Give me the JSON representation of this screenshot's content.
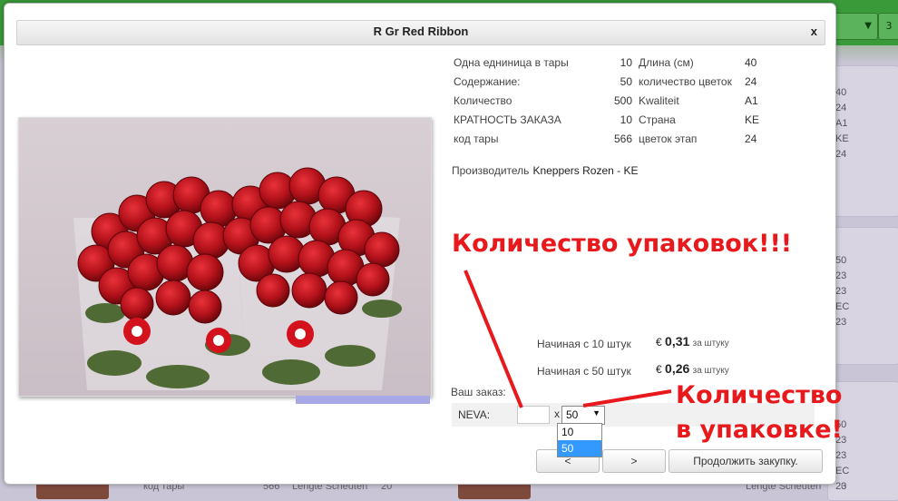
{
  "modal": {
    "title": "R Gr Red Ribbon",
    "close_label": "x"
  },
  "specs_left": [
    {
      "label": "Одна едниница в тары",
      "value": "10"
    },
    {
      "label": "Содержание:",
      "value": "50"
    },
    {
      "label": "Количество",
      "value": "500"
    },
    {
      "label": "КРАТНОСТЬ ЗАКАЗА",
      "value": "10"
    },
    {
      "label": "код тары",
      "value": "566"
    }
  ],
  "specs_right": [
    {
      "label": "Длина (см)",
      "value": "40"
    },
    {
      "label": "количество цветок",
      "value": "24"
    },
    {
      "label": "Kwaliteit",
      "value": "A1"
    },
    {
      "label": "Страна",
      "value": "KE"
    },
    {
      "label": "цветок этап",
      "value": "24"
    }
  ],
  "producer": {
    "label": "Производитель",
    "value": "Kneppers Rozen - KE"
  },
  "prices": [
    {
      "label": "Начиная с 10 штук",
      "currency": "€",
      "price": "0,31",
      "unit": "за штуку"
    },
    {
      "label": "Начиная с 50 штук",
      "currency": "€",
      "price": "0,26",
      "unit": "за штуку"
    }
  ],
  "order": {
    "label": "Ваш заказ:",
    "row_name": "NEVA:",
    "quantity_value": "",
    "multiply": "x",
    "selected": "50",
    "options": [
      "10",
      "50"
    ]
  },
  "buttons": {
    "prev": "<",
    "next": ">",
    "continue": "Продолжить закупку."
  },
  "annotations": {
    "packages": "Количество упаковок!!!",
    "per_package_line1": "Количество",
    "per_package_line2": "в упаковке!"
  },
  "background": {
    "select_value": "",
    "button_label": "3",
    "col_top": [
      "40",
      "24",
      "A1",
      "KE",
      "24"
    ],
    "col_mid": [
      "50",
      "23",
      "23",
      "EC",
      "23"
    ],
    "col_low": [
      "50",
      "23",
      "23",
      "EC",
      "23"
    ],
    "bottom_row": [
      "код тары",
      "566",
      "Lengte Scheuten",
      "20"
    ],
    "bottom_right": [
      "Lengte Scheuten",
      "20"
    ]
  },
  "colors": {
    "accent_green": "#3a9a3a",
    "annotation_red": "#e8191c",
    "selection_blue": "#3399ff"
  }
}
